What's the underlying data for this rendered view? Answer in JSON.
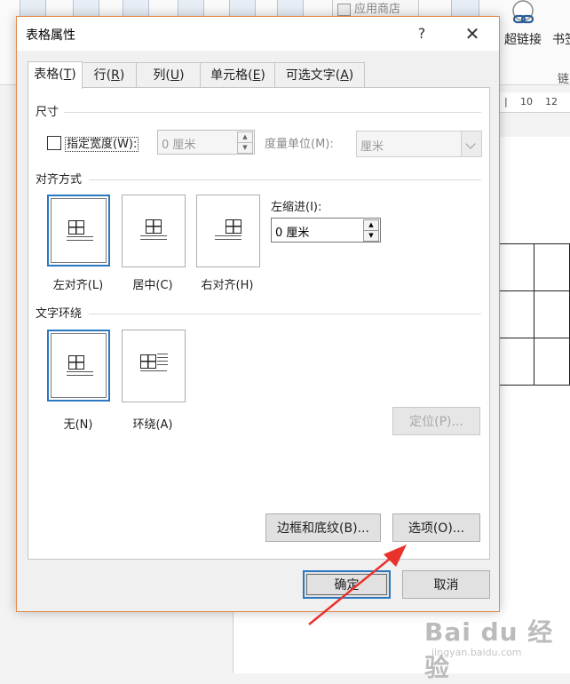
{
  "background": {
    "ribbon": {
      "store_label": "应用商店",
      "hyperlink_label": "超链接",
      "bookmark_label": "书签",
      "group_label": "链"
    },
    "ruler": {
      "tick1": "10",
      "tick2": "12"
    },
    "watermark": {
      "text": "Bai du 经验",
      "sub": "jingyan.baidu.com"
    }
  },
  "dialog": {
    "title": "表格属性",
    "help": "?",
    "close": "✕",
    "tabs": [
      {
        "text": "表格(",
        "key": "T",
        "end": ")"
      },
      {
        "text": "行(",
        "key": "R",
        "end": ")"
      },
      {
        "text": "列(",
        "key": "U",
        "end": ")"
      },
      {
        "text": "单元格(",
        "key": "E",
        "end": ")"
      },
      {
        "text": "可选文字(",
        "key": "A",
        "end": ")"
      }
    ],
    "size": {
      "section": "尺寸",
      "preferred_width_label": "指定宽度(W):",
      "preferred_width_checked": false,
      "width_value": "0 厘米",
      "measure_label": "度量单位(M):",
      "measure_value": "厘米"
    },
    "alignment": {
      "section": "对齐方式",
      "options": [
        "左对齐(L)",
        "居中(C)",
        "右对齐(H)"
      ],
      "selected": "左对齐(L)",
      "indent_label": "左缩进(I):",
      "indent_value": "0 厘米"
    },
    "wrapping": {
      "section": "文字环绕",
      "options": [
        "无(N)",
        "环绕(A)"
      ],
      "selected": "无(N)",
      "position_button": "定位(P)..."
    },
    "buttons": {
      "borders": "边框和底纹(B)...",
      "options": "选项(O)...",
      "ok": "确定",
      "cancel": "取消"
    }
  },
  "colors": {
    "accent": "#2b78c0",
    "annotation_arrow": "#e8322b",
    "dialog_border": "#e08a4a"
  }
}
